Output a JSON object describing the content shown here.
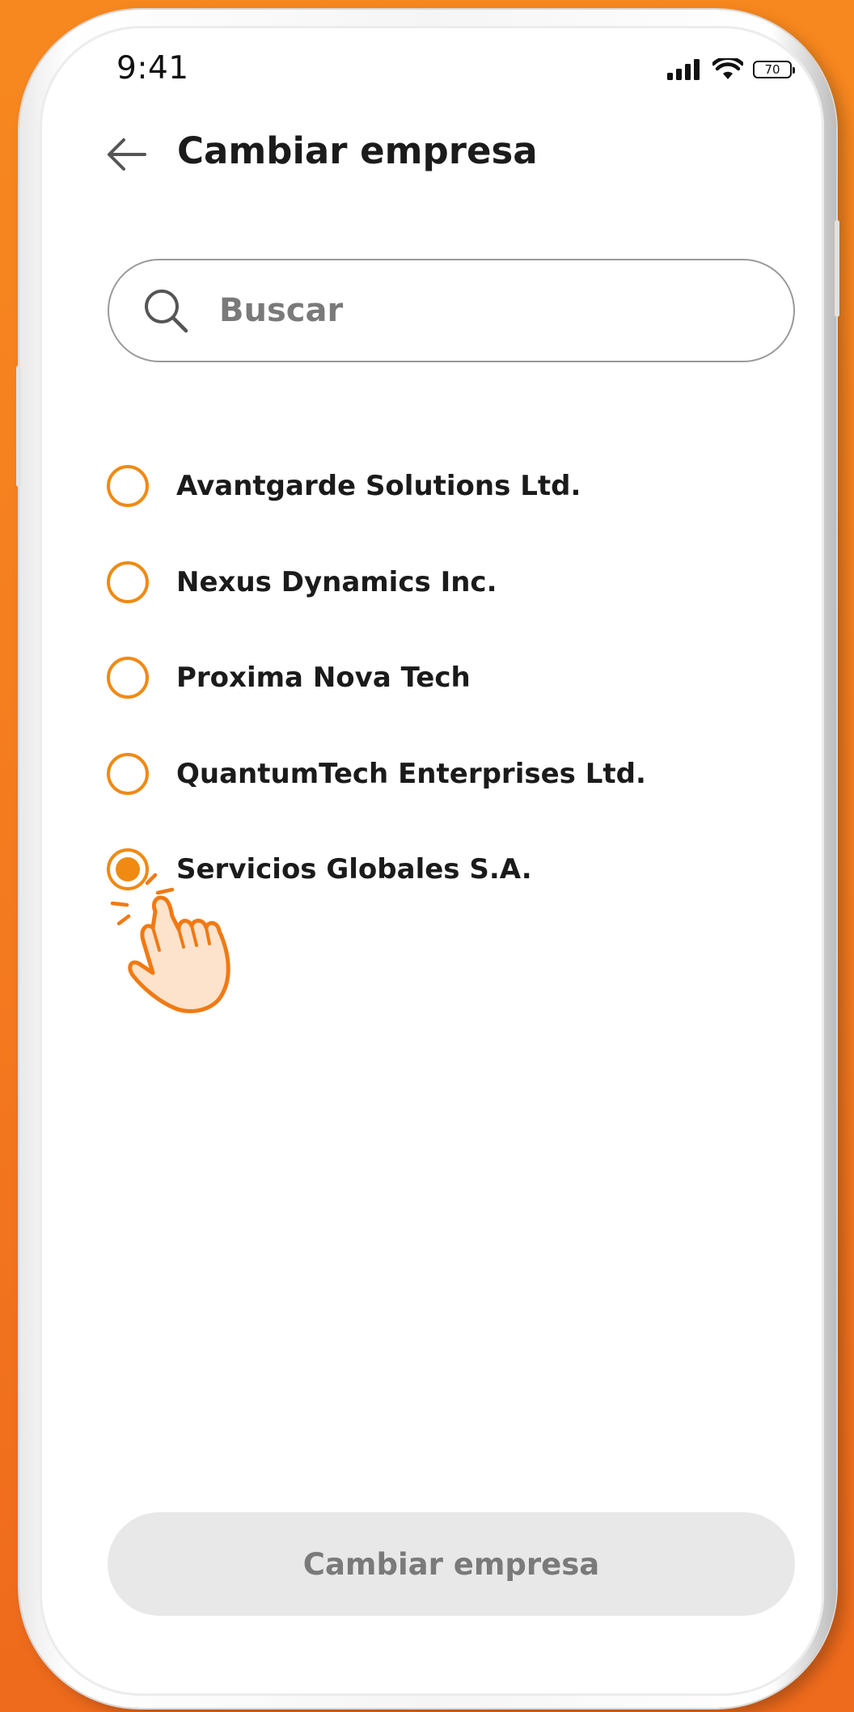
{
  "status_bar": {
    "time": "9:41",
    "battery": "70",
    "signal_icon": "signal-bars-icon",
    "wifi_icon": "wifi-icon"
  },
  "header": {
    "title": "Cambiar empresa",
    "back_icon": "arrow-left-icon"
  },
  "search": {
    "placeholder": "Buscar",
    "value": "",
    "icon": "search-icon"
  },
  "companies": [
    {
      "label": "Avantgarde Solutions Ltd.",
      "selected": false
    },
    {
      "label": "Nexus Dynamics Inc.",
      "selected": false
    },
    {
      "label": "Proxima Nova Tech",
      "selected": false
    },
    {
      "label": "QuantumTech Enterprises Ltd.",
      "selected": false
    },
    {
      "label": "Servicios Globales S.A.",
      "selected": true
    }
  ],
  "submit_button": {
    "label": "Cambiar empresa",
    "state": "disabled"
  },
  "colors": {
    "accent": "#f08a12",
    "background": "#f47a1f",
    "button_disabled_bg": "#e8e8e8",
    "button_disabled_text": "#7a7a7a"
  }
}
